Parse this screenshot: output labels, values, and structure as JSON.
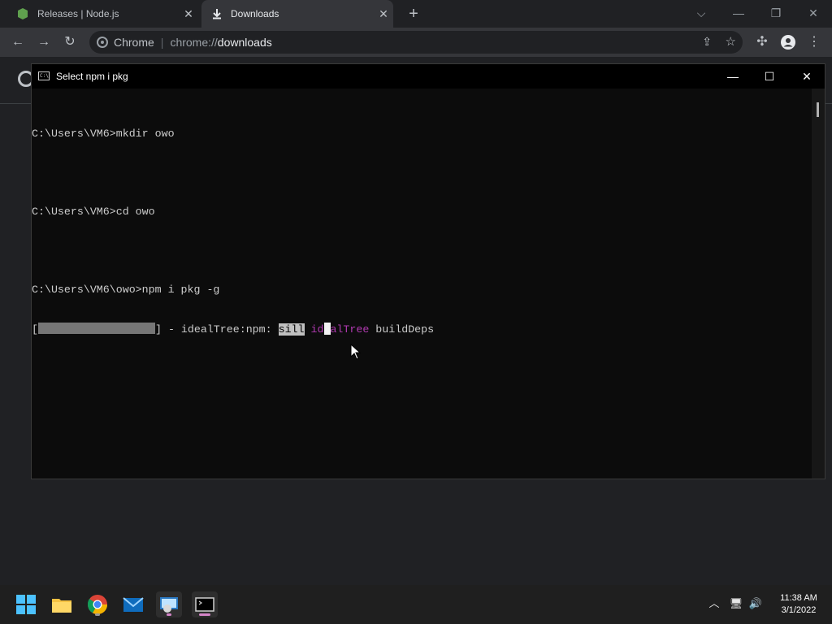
{
  "browser": {
    "tabs": [
      {
        "title": "Releases | Node.js",
        "icon": "nodejs-shield-icon"
      },
      {
        "title": "Downloads",
        "icon": "download-icon",
        "active": true
      }
    ],
    "omnibox": {
      "site_label": "Chrome",
      "url_host": "chrome://",
      "url_path": "downloads"
    }
  },
  "console": {
    "title": "Select npm i pkg",
    "lines": [
      "C:\\Users\\VM6>mkdir owo",
      "",
      "C:\\Users\\VM6>cd owo",
      "",
      "C:\\Users\\VM6\\owo>npm i pkg -g"
    ],
    "progress": {
      "open_bracket": "[",
      "close_and_text": "] - idealTree:npm: ",
      "level": "sill",
      "stage": "idealTree",
      "task": " buildDeps"
    }
  },
  "taskbar": {
    "apps": [
      "start-icon",
      "file-explorer-icon",
      "chrome-icon",
      "mail-icon",
      "remote-desktop-icon",
      "terminal-icon"
    ],
    "clock": {
      "time": "11:38 AM",
      "date": "3/1/2022"
    }
  },
  "colors": {
    "console_bg": "#0c0c0c",
    "highlight": "#c0c0c0",
    "magenta": "#b13ab1",
    "taskbar": "#1f1f1f"
  }
}
